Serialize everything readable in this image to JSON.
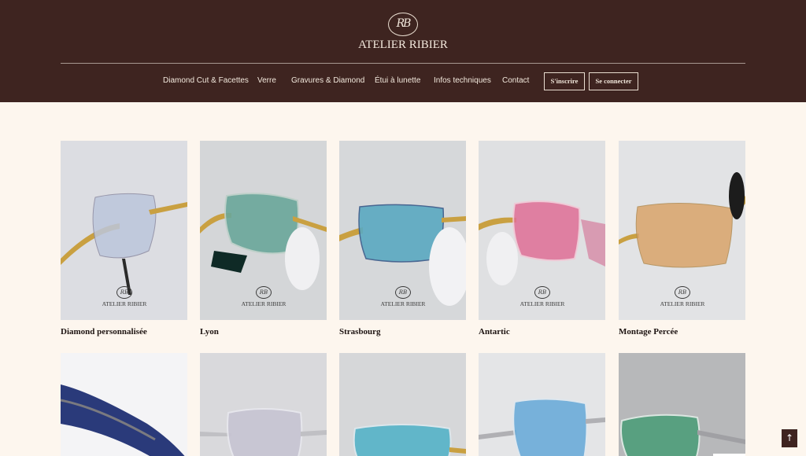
{
  "brand": {
    "monogram": "RB",
    "name": "ATELIER RIBIER"
  },
  "nav": {
    "links": [
      "Diamond Cut & Facettes",
      "Verre",
      "Gravures & Diamond",
      "Étui à lunette",
      "Infos techniques",
      "Contact"
    ],
    "signup_label": "S'inscrire",
    "login_label": "Se connecter"
  },
  "products": [
    {
      "title": "Diamond personnalisée",
      "lens_color": "#bcc6dc",
      "frame": "gold"
    },
    {
      "title": "Lyon",
      "lens_color": "#6aa79a",
      "frame": "gold"
    },
    {
      "title": "Strasbourg",
      "lens_color": "#5aa9c1",
      "frame": "gold"
    },
    {
      "title": "Antartic",
      "lens_color": "#e06f96",
      "frame": "gold"
    },
    {
      "title": "Montage Percée",
      "lens_color": "#d9a46a",
      "frame": "gold"
    },
    {
      "lens_color": "#2a3a7a",
      "frame": "dark"
    },
    {
      "lens_color": "#c7c4d3",
      "frame": "silver"
    },
    {
      "lens_color": "#55b3c8",
      "frame": "gold"
    },
    {
      "lens_color": "#64a9d8",
      "frame": "silver"
    },
    {
      "lens_color": "#4e9e7a",
      "frame": "silver"
    }
  ],
  "watermark": {
    "monogram": "RB",
    "name": "ATELIER RIBIER"
  },
  "scroll_top_icon": "arrow-up-icon"
}
